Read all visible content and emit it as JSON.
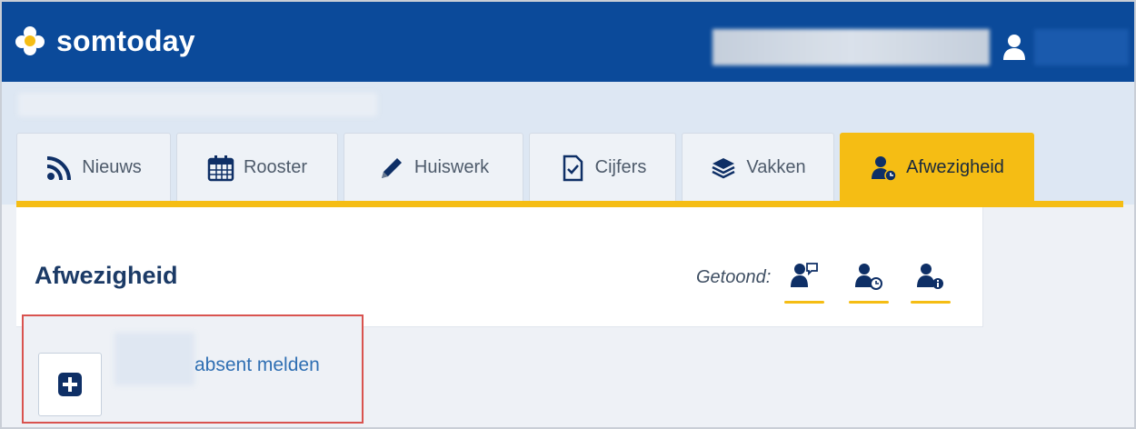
{
  "header": {
    "logo_text": "somtoday",
    "colors": {
      "brand": "#0b4a9a",
      "accent": "#f5bd14"
    }
  },
  "tabs": [
    {
      "label": "Nieuws",
      "icon": "rss-icon"
    },
    {
      "label": "Rooster",
      "icon": "calendar-icon"
    },
    {
      "label": "Huiswerk",
      "icon": "pencil-icon"
    },
    {
      "label": "Cijfers",
      "icon": "document-check-icon"
    },
    {
      "label": "Vakken",
      "icon": "books-icon"
    },
    {
      "label": "Afwezigheid",
      "icon": "user-clock-icon",
      "active": true
    }
  ],
  "main": {
    "title": "Afwezigheid",
    "shown_label": "Getoond:",
    "filters": [
      {
        "icon": "user-chat-icon"
      },
      {
        "icon": "user-clock-icon"
      },
      {
        "icon": "user-info-icon"
      }
    ]
  },
  "report": {
    "link_text": "absent melden"
  }
}
